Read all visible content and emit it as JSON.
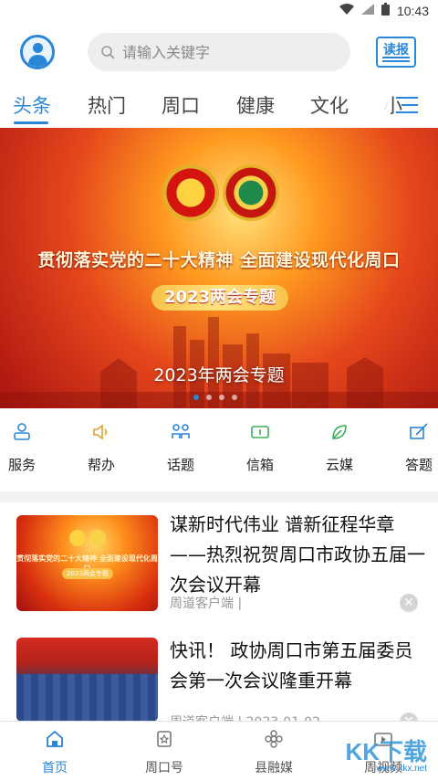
{
  "status_bar": {
    "time": "10:43"
  },
  "header": {
    "search": {
      "placeholder": "请输入关键字"
    },
    "read_button": "读报"
  },
  "tabs": [
    {
      "label": "头条",
      "active": true
    },
    {
      "label": "热门"
    },
    {
      "label": "周口"
    },
    {
      "label": "健康"
    },
    {
      "label": "文化"
    },
    {
      "label": "小"
    }
  ],
  "banner": {
    "headline": "贯彻落实党的二十大精神 全面建设现代化周口",
    "pill": "2023两会专题",
    "caption": "2023年两会专题",
    "slides": 4,
    "active_slide": 1
  },
  "services": [
    {
      "label": "服务",
      "icon": "user-stamp-icon"
    },
    {
      "label": "帮办",
      "icon": "speaker-icon"
    },
    {
      "label": "话题",
      "icon": "people-icon"
    },
    {
      "label": "信箱",
      "icon": "mail-icon"
    },
    {
      "label": "云媒",
      "icon": "leaf-icon"
    },
    {
      "label": "答题",
      "icon": "pen-paper-icon"
    }
  ],
  "news": [
    {
      "title": "谋新时代伟业 谱新征程华章——热烈祝贺周口市政协五届一次会议开幕",
      "source": "周道客户端",
      "thumb_caption": "贯彻落实党的二十大精神 全面建设现代化周口",
      "thumb_pill": "2023两会专题"
    },
    {
      "title": "快讯！ 政协周口市第五届委员会第一次会议隆重开幕",
      "source": "周道客户端",
      "date": "2023-01-02"
    }
  ],
  "bottom_nav": [
    {
      "label": "首页",
      "icon": "home-icon",
      "active": true
    },
    {
      "label": "周口号",
      "icon": "bookmark-icon"
    },
    {
      "label": "县融媒",
      "icon": "flower-icon"
    },
    {
      "label": "周视频",
      "icon": "video-icon"
    }
  ],
  "watermark": {
    "text": "KK下载",
    "url": "www.kkx.net"
  },
  "colors": {
    "accent": "#2a86d6",
    "banner_red": "#d4140e"
  }
}
